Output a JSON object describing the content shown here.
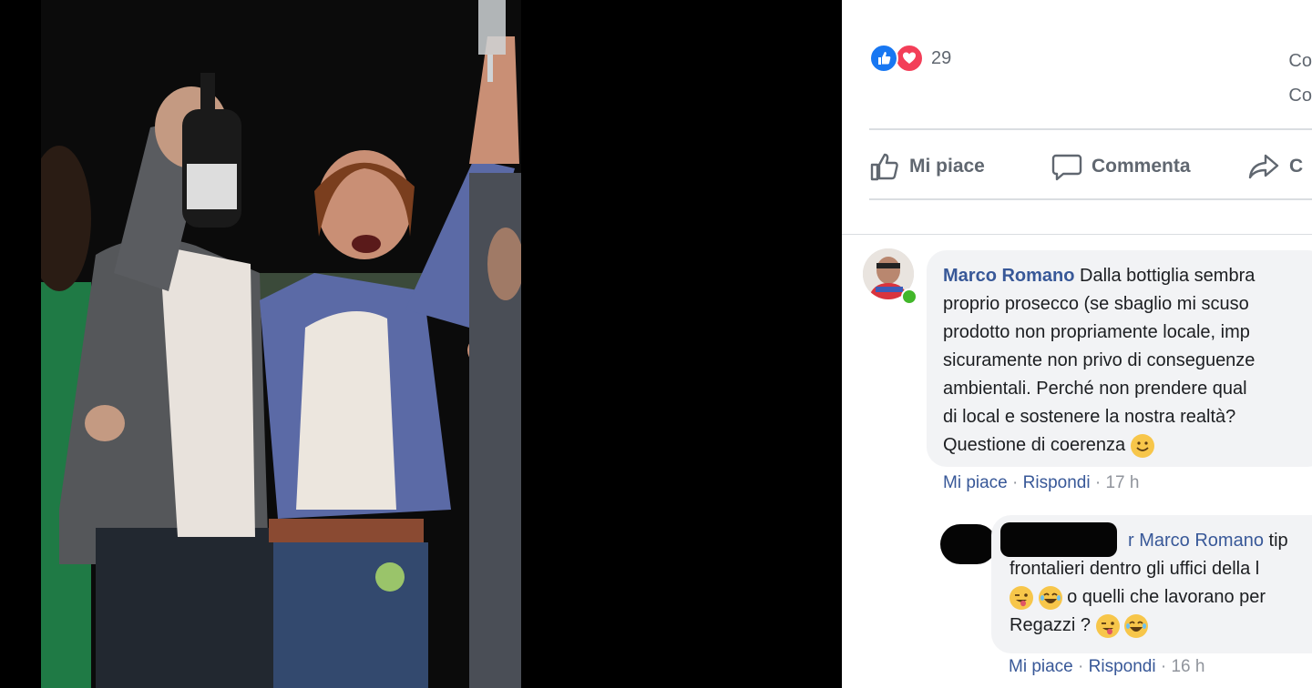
{
  "post": {
    "reactions": {
      "count": "29",
      "icons": [
        "like-icon",
        "love-icon"
      ]
    },
    "side_counts": [
      "Co",
      "Co"
    ],
    "actions": {
      "like_label": "Mi piace",
      "comment_label": "Commenta",
      "share_label": "C"
    }
  },
  "comments": [
    {
      "author": "Marco Romano",
      "lines": [
        "Dalla bottiglia sembra",
        "proprio prosecco (se sbaglio mi scuso",
        "prodotto non propriamente locale, imp",
        "sicuramente non privo di conseguenze",
        "ambientali. Perché non prendere qual",
        "di local e sostenere la nostra realtà?",
        "Questione di coerenza"
      ],
      "meta": {
        "like": "Mi piace",
        "sep": " · ",
        "reply": "Rispondi",
        "time": "17 h"
      }
    },
    {
      "author_fragment": "r",
      "mention": "Marco Romano",
      "line1_tail": "tip",
      "lines": [
        "frontalieri dentro gli uffici della l",
        "o quelli che lavorano per",
        "Regazzi ?"
      ],
      "meta": {
        "like": "Mi piace",
        "sep": " · ",
        "reply": "Rispondi",
        "time": "16 h"
      }
    }
  ],
  "colors": {
    "link": "#385898",
    "like_blue": "#1877f2",
    "love_red": "#f33e58",
    "meta_gray": "#90949c",
    "bubble_bg": "#f2f3f5"
  }
}
